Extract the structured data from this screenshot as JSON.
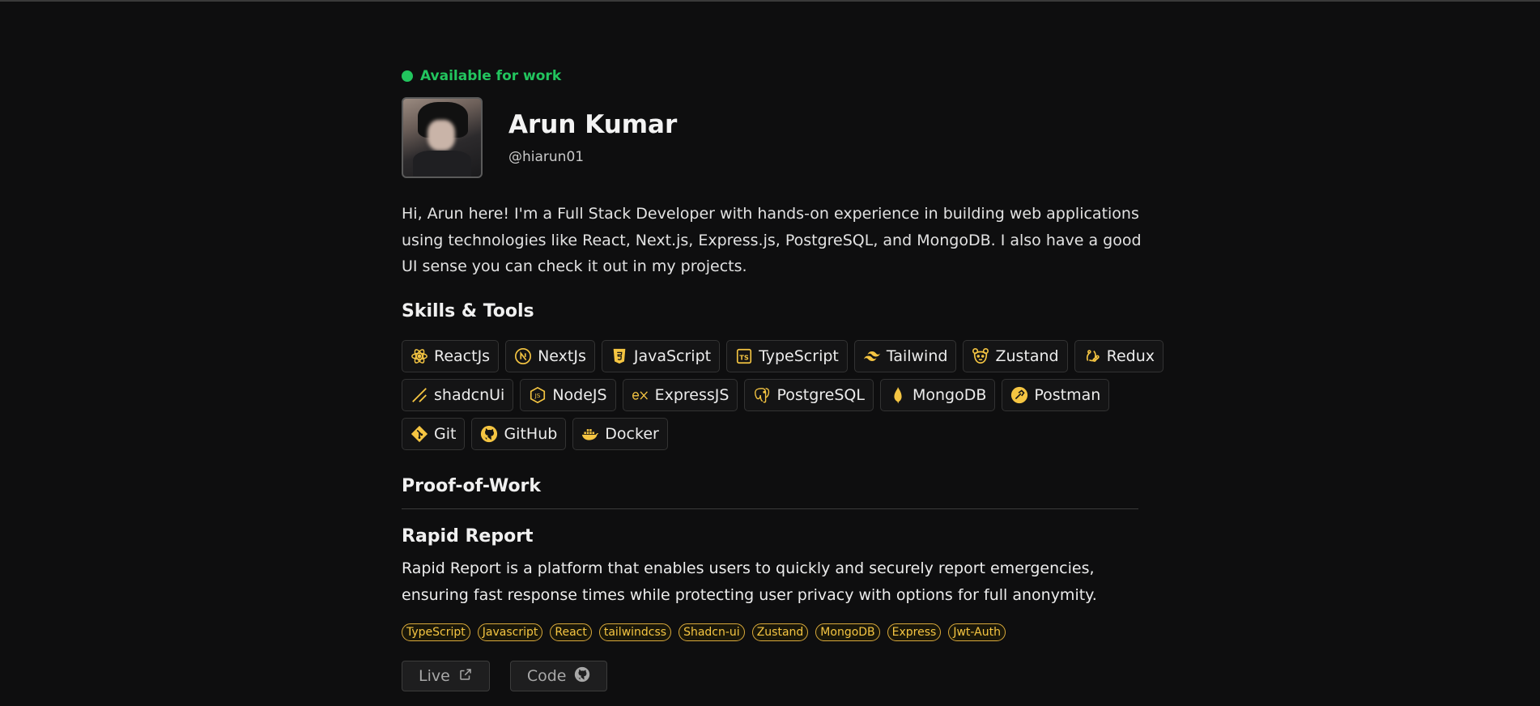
{
  "status": {
    "text": "Available for work",
    "color": "#22c55e"
  },
  "profile": {
    "name": "Arun Kumar",
    "handle": "@hiarun01"
  },
  "bio": "Hi, Arun here! I'm a Full Stack Developer with hands-on experience in building web applications using technologies like React, Next.js, Express.js, PostgreSQL, and MongoDB. I also have a good UI sense you can check it out in my projects.",
  "skills_heading": "Skills & Tools",
  "skills": [
    [
      {
        "label": "ReactJs",
        "icon": "react-icon"
      },
      {
        "label": "NextJs",
        "icon": "nextjs-icon"
      },
      {
        "label": "JavaScript",
        "icon": "javascript-icon"
      },
      {
        "label": "TypeScript",
        "icon": "typescript-icon"
      },
      {
        "label": "Tailwind",
        "icon": "tailwind-icon"
      },
      {
        "label": "Zustand",
        "icon": "zustand-icon"
      },
      {
        "label": "Redux",
        "icon": "redux-icon"
      }
    ],
    [
      {
        "label": "shadcnUi",
        "icon": "shadcn-icon"
      },
      {
        "label": "NodeJS",
        "icon": "nodejs-icon"
      },
      {
        "label": "ExpressJS",
        "icon": "express-icon"
      },
      {
        "label": "PostgreSQL",
        "icon": "postgresql-icon"
      },
      {
        "label": "MongoDB",
        "icon": "mongodb-icon"
      },
      {
        "label": "Postman",
        "icon": "postman-icon"
      }
    ],
    [
      {
        "label": "Git",
        "icon": "git-icon"
      },
      {
        "label": "GitHub",
        "icon": "github-icon"
      },
      {
        "label": "Docker",
        "icon": "docker-icon"
      }
    ]
  ],
  "proof_heading": "Proof-of-Work",
  "project": {
    "title": "Rapid Report",
    "description": "Rapid Report is a platform that enables users to quickly and securely report emergencies, ensuring fast response times while protecting user privacy with options for full anonymity.",
    "tags": [
      "TypeScript",
      "Javascript",
      "React",
      "tailwindcss",
      "Shadcn-ui",
      "Zustand",
      "MongoDB",
      "Express",
      "Jwt-Auth"
    ],
    "live_label": "Live",
    "code_label": "Code"
  },
  "colors": {
    "accent": "#f5c542",
    "background": "#0e0e0f"
  }
}
